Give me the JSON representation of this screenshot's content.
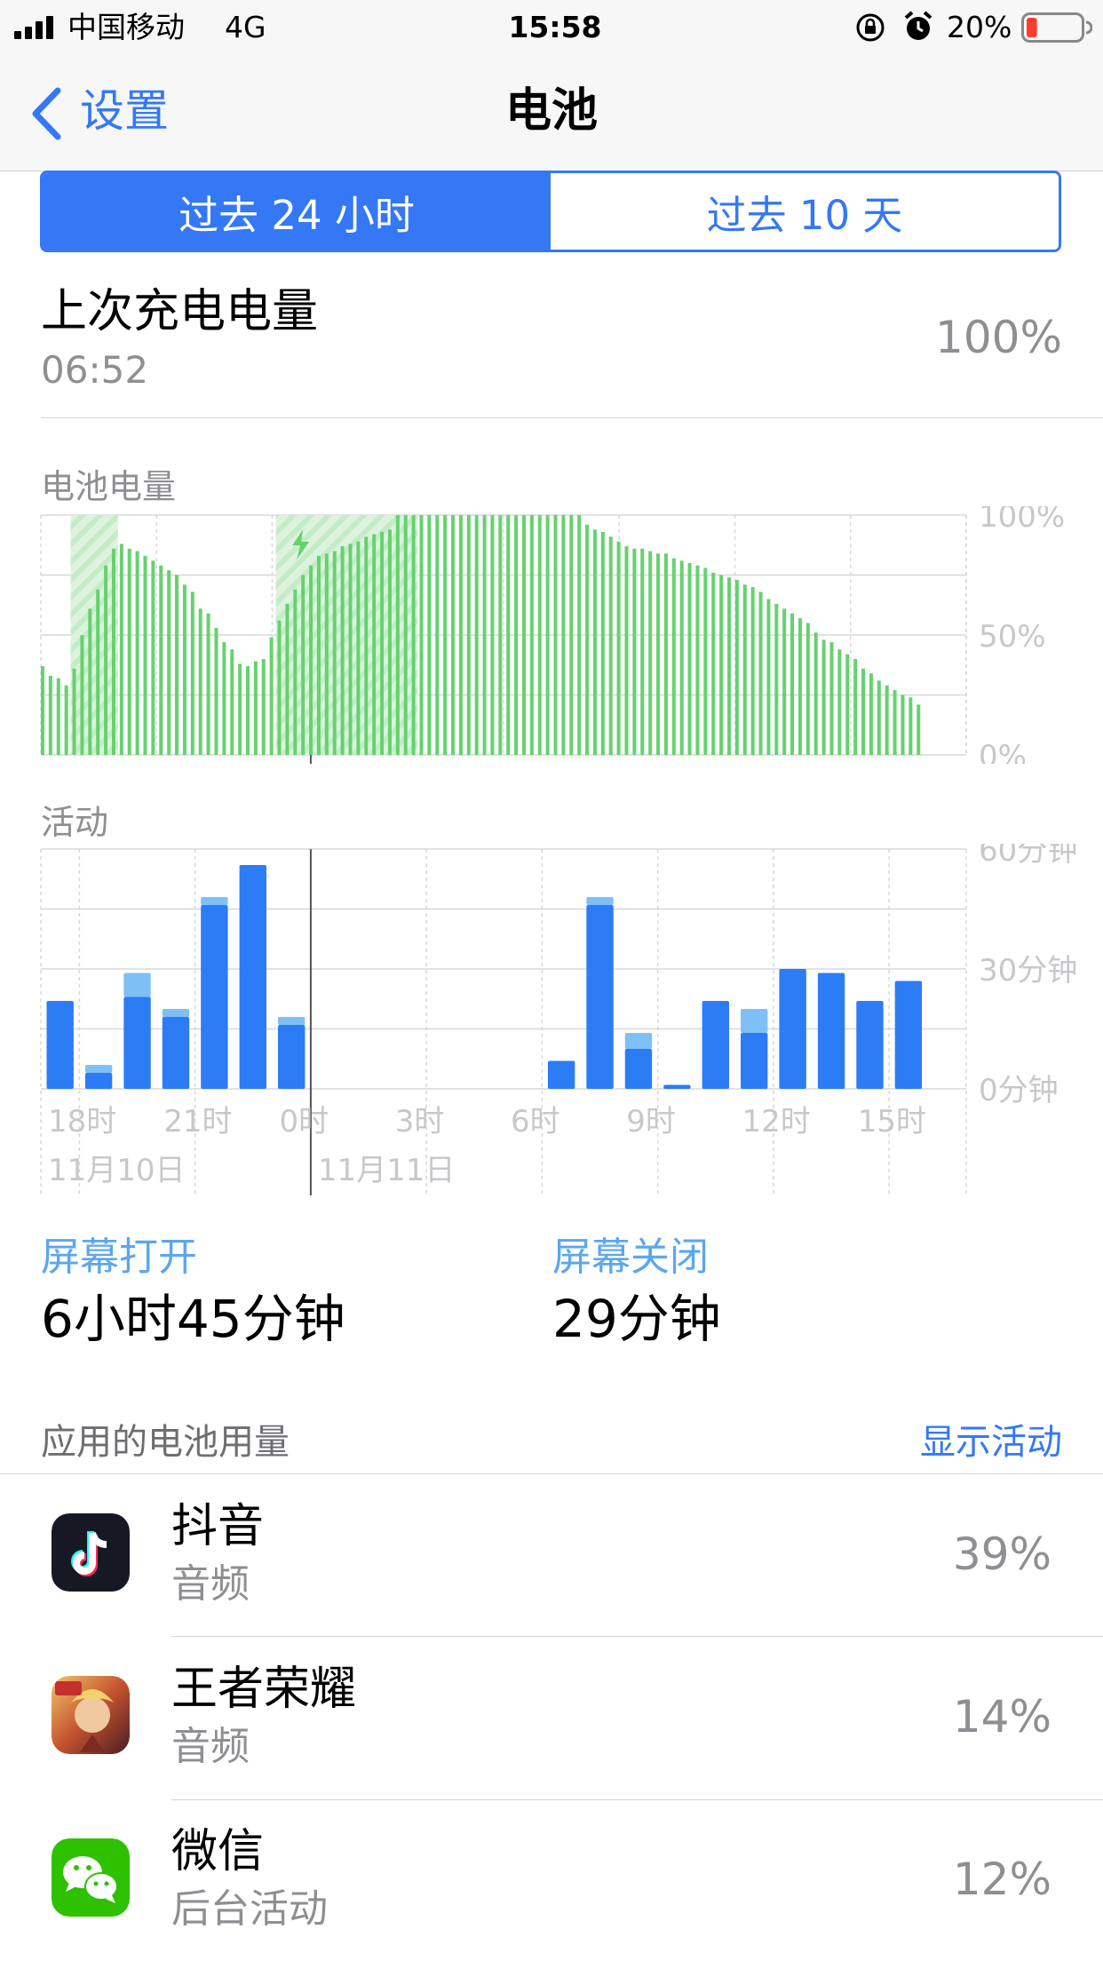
{
  "status_bar": {
    "carrier": "中国移动",
    "network": "4G",
    "time": "15:58",
    "battery_percent_label": "20%",
    "battery_level": 0.2,
    "icons": [
      "signal-bars-icon",
      "orientation-lock-icon",
      "alarm-icon",
      "battery-icon"
    ]
  },
  "nav": {
    "back_label": "设置",
    "title": "电池"
  },
  "segmented": {
    "options": [
      "过去 24 小时",
      "过去 10 天"
    ],
    "selected_index": 0
  },
  "last_charge": {
    "label": "上次充电电量",
    "time": "06:52",
    "value": "100%"
  },
  "colors": {
    "accent": "#3478f6",
    "battery_green": "#65d26e",
    "battery_green_light": "#c9efcb",
    "activity_blue": "#2c7cf6",
    "activity_light_blue": "#7ec0f5",
    "grid": "#d8d8d8",
    "low_battery_red": "#ff3b30"
  },
  "chart_data": [
    {
      "type": "bar",
      "title": "电池电量",
      "ylim": [
        0,
        100
      ],
      "yticks": [
        "100%",
        "50%",
        "0%"
      ],
      "x_note": "15-minute samples, from 17:00 (11月10日) to 15:45 (11月11日)",
      "values": [
        37,
        33,
        32,
        29,
        36,
        50,
        61,
        69,
        79,
        86,
        88,
        86,
        85,
        83,
        81,
        79,
        77,
        75,
        71,
        68,
        61,
        59,
        53,
        47,
        44,
        38,
        37,
        39,
        40,
        49,
        56,
        63,
        69,
        75,
        79,
        83,
        84,
        85,
        87,
        88,
        89,
        91,
        92,
        93,
        94,
        100,
        100,
        100,
        100,
        100,
        100,
        100,
        100,
        100,
        100,
        100,
        100,
        100,
        100,
        100,
        100,
        100,
        100,
        100,
        100,
        100,
        100,
        100,
        100,
        96,
        94,
        93,
        91,
        89,
        87,
        86,
        86,
        85,
        84,
        84,
        82,
        81,
        80,
        79,
        78,
        76,
        75,
        74,
        73,
        71,
        70,
        68,
        65,
        63,
        61,
        59,
        57,
        55,
        51,
        48,
        47,
        44,
        42,
        40,
        36,
        34,
        31,
        29,
        27,
        25,
        24,
        21
      ],
      "charging_ranges": [
        [
          4,
          9
        ],
        [
          30,
          47
        ]
      ],
      "charge_marker_index": 33,
      "grid": true
    },
    {
      "type": "bar",
      "title": "活动",
      "ylim": [
        0,
        60
      ],
      "yticks": [
        "60分钟",
        "30分钟",
        "0分钟"
      ],
      "categories": [
        "17时",
        "18时",
        "19时",
        "20时",
        "21时",
        "22时",
        "23时",
        "0时",
        "1时",
        "2时",
        "3时",
        "4时",
        "5时",
        "6时",
        "7时",
        "8时",
        "9时",
        "10时",
        "11时",
        "12时",
        "13时",
        "14时",
        "15时"
      ],
      "x_tick_labels": [
        "18时",
        "21时",
        "0时",
        "3时",
        "6时",
        "9时",
        "12时",
        "15时"
      ],
      "date_labels": [
        "11月10日",
        "11月11日"
      ],
      "series": [
        {
          "name": "屏幕打开",
          "values": [
            22,
            4,
            23,
            18,
            46,
            56,
            16,
            0,
            0,
            0,
            0,
            0,
            0,
            7,
            46,
            10,
            1,
            22,
            14,
            30,
            29,
            22,
            27
          ]
        },
        {
          "name": "屏幕关闭",
          "values": [
            0,
            2,
            6,
            2,
            2,
            0,
            2,
            0,
            0,
            0,
            0,
            0,
            0,
            0,
            2,
            4,
            0,
            0,
            6,
            0,
            0,
            0,
            0
          ]
        }
      ],
      "grid": true
    }
  ],
  "screen_time": {
    "on_label": "屏幕打开",
    "on_value": "6小时45分钟",
    "off_label": "屏幕关闭",
    "off_value": "29分钟"
  },
  "usage": {
    "header": "应用的电池用量",
    "toggle": "显示活动",
    "apps": [
      {
        "name": "抖音",
        "sub": "音频",
        "pct": "39%",
        "icon": "douyin-app-icon"
      },
      {
        "name": "王者荣耀",
        "sub": "音频",
        "pct": "14%",
        "icon": "honor-of-kings-app-icon"
      },
      {
        "name": "微信",
        "sub": "后台活动",
        "pct": "12%",
        "icon": "wechat-app-icon"
      }
    ]
  }
}
